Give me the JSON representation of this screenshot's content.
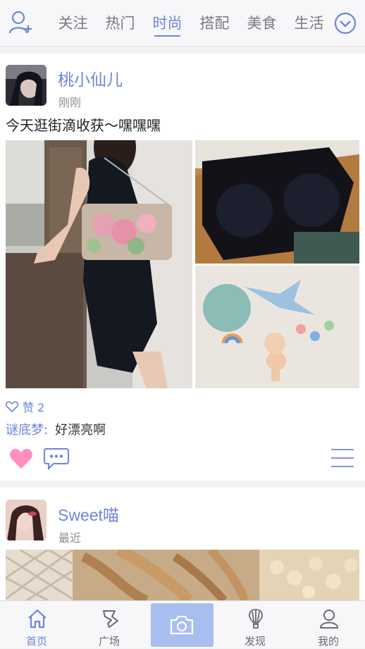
{
  "top_tabs": [
    "关注",
    "热门",
    "时尚",
    "搭配",
    "美食",
    "生活"
  ],
  "active_tab_index": 2,
  "post1": {
    "author": "桃小仙儿",
    "time": "刚刚",
    "text": "今天逛街滴收获～嘿嘿嘿",
    "likes_label": "赞 2",
    "comment": {
      "user": "谜底梦:",
      "text": "好漂亮啊"
    }
  },
  "post2": {
    "author": "Sweet喵",
    "time": "最近"
  },
  "bottom_nav": [
    "首页",
    "广场",
    "发现",
    "我的"
  ],
  "colors": {
    "accent": "#6f84dc",
    "heart": "#ff8fbf",
    "camera_bg": "#a9bef0"
  },
  "icons": [
    "add-user-icon",
    "chevron-down-circle-icon",
    "heart-outline-icon",
    "heart-filled-icon",
    "chat-bubble-icon",
    "menu-lines-icon",
    "home-icon",
    "flag-icon",
    "camera-icon",
    "balloon-icon",
    "user-icon"
  ]
}
